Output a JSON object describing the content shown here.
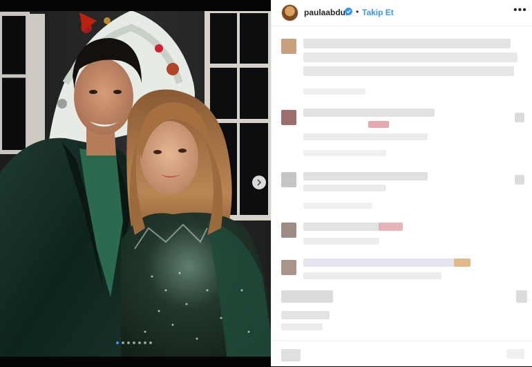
{
  "post": {
    "username": "paulaabdul",
    "follow_label": "Takip Et",
    "more_label": "•••",
    "carousel_next_label": "›",
    "carousel_dots": 7,
    "carousel_active_index": 0
  },
  "icons": {
    "verified": "verified-badge-icon",
    "more": "more-options-icon",
    "next": "chevron-right-icon"
  },
  "colors": {
    "accent": "#3897f0",
    "text": "#262626",
    "border": "#efefef"
  }
}
